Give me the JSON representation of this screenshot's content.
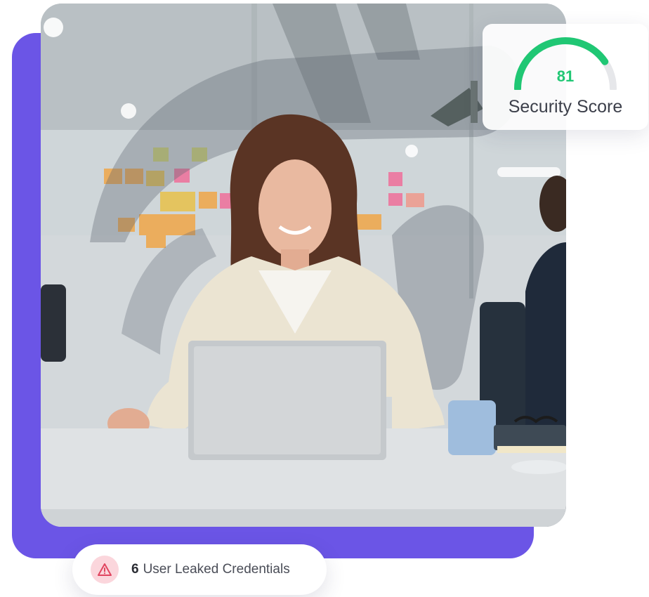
{
  "security_score": {
    "value": "81",
    "label": "Security Score",
    "fraction": 0.81,
    "gauge_color": "#20c774",
    "track_color": "#e6e7ea"
  },
  "leak_alert": {
    "icon": "warning-triangle-icon",
    "count": "6",
    "text": "User Leaked Credentials",
    "badge_color": "#fbd6dc",
    "icon_color": "#e0455f"
  },
  "colors": {
    "accent_purple": "#6b55e6"
  }
}
